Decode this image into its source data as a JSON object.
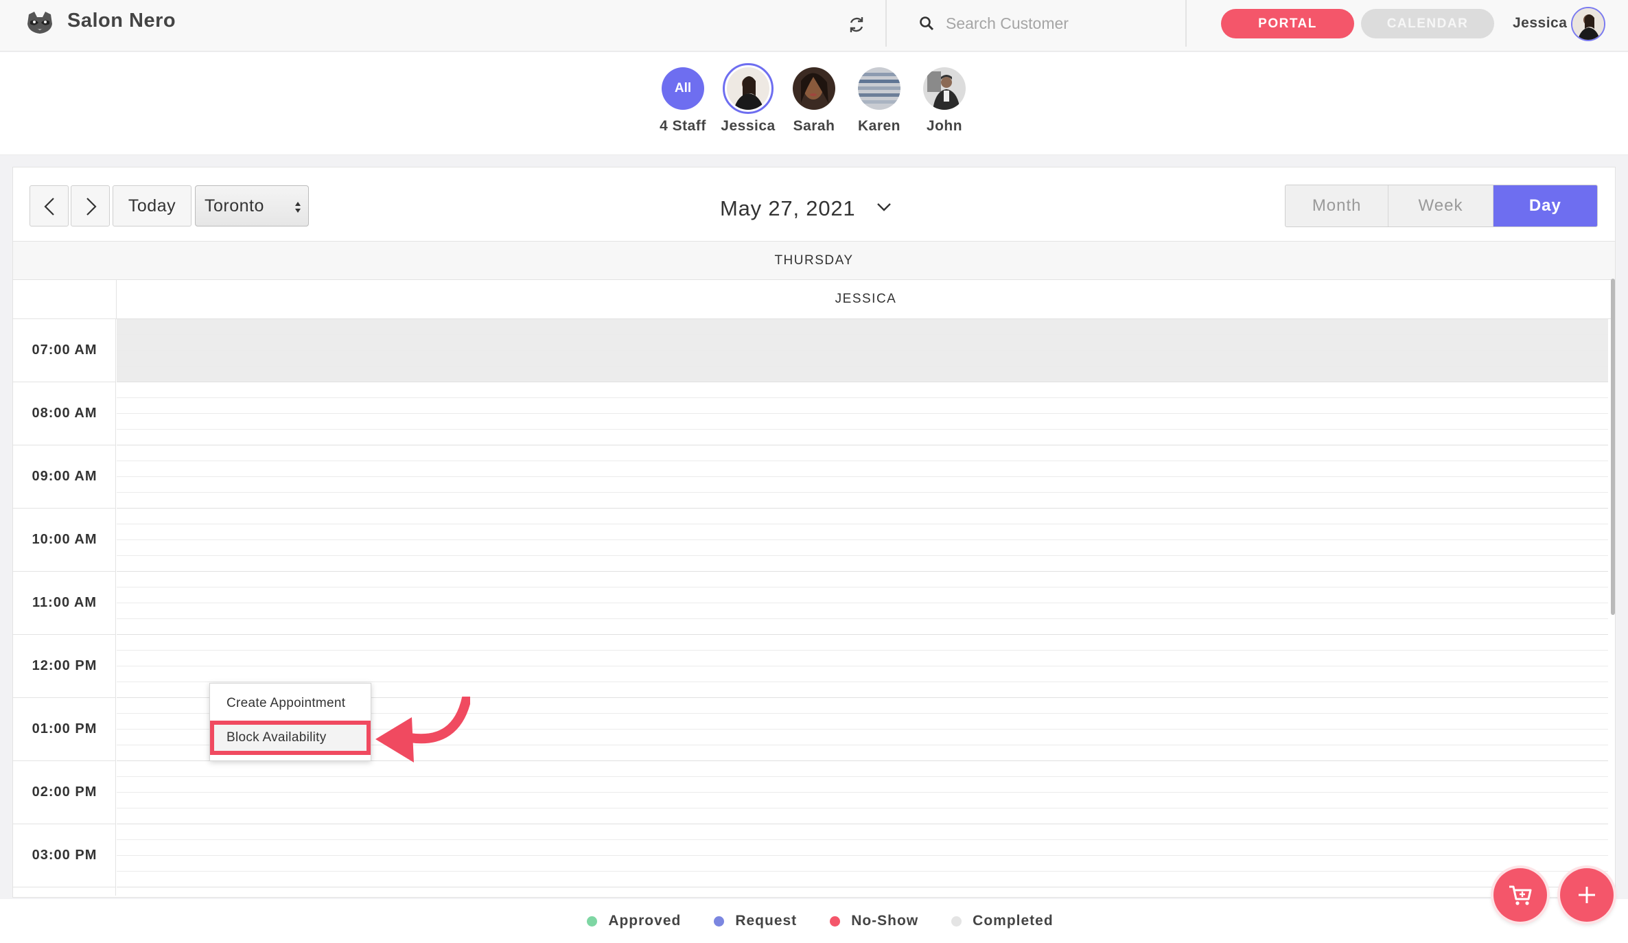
{
  "app": {
    "brand": "Salon Nero",
    "search": {
      "placeholder": "Search Customer",
      "value": ""
    },
    "portal_label": "PORTAL",
    "calendar_label": "CALENDAR",
    "user_name": "Jessica"
  },
  "staff": [
    {
      "label": "4 Staff",
      "badge": "All"
    },
    {
      "label": "Jessica",
      "selected": true
    },
    {
      "label": "Sarah"
    },
    {
      "label": "Karen"
    },
    {
      "label": "John"
    }
  ],
  "toolbar": {
    "today_label": "Today",
    "timezone": "Toronto",
    "date": "May 27, 2021",
    "views": [
      "Month",
      "Week",
      "Day"
    ],
    "active_view": "Day"
  },
  "day_name": "THURSDAY",
  "column_staff": "JESSICA",
  "time_slots": [
    "07:00 AM",
    "08:00 AM",
    "09:00 AM",
    "10:00 AM",
    "11:00 AM",
    "12:00 PM",
    "01:00 PM",
    "02:00 PM",
    "03:00 PM"
  ],
  "context_menu": {
    "items": [
      "Create Appointment",
      "Block Availability"
    ],
    "highlighted": "Block Availability"
  },
  "legend": [
    {
      "label": "Approved",
      "color": "#7ed6a3"
    },
    {
      "label": "Request",
      "color": "#7b86e0"
    },
    {
      "label": "No-Show",
      "color": "#f4566a"
    },
    {
      "label": "Completed",
      "color": "#e4e4e4"
    }
  ],
  "colors": {
    "accent": "#6e6ef0",
    "brand_red": "#f4566a"
  }
}
